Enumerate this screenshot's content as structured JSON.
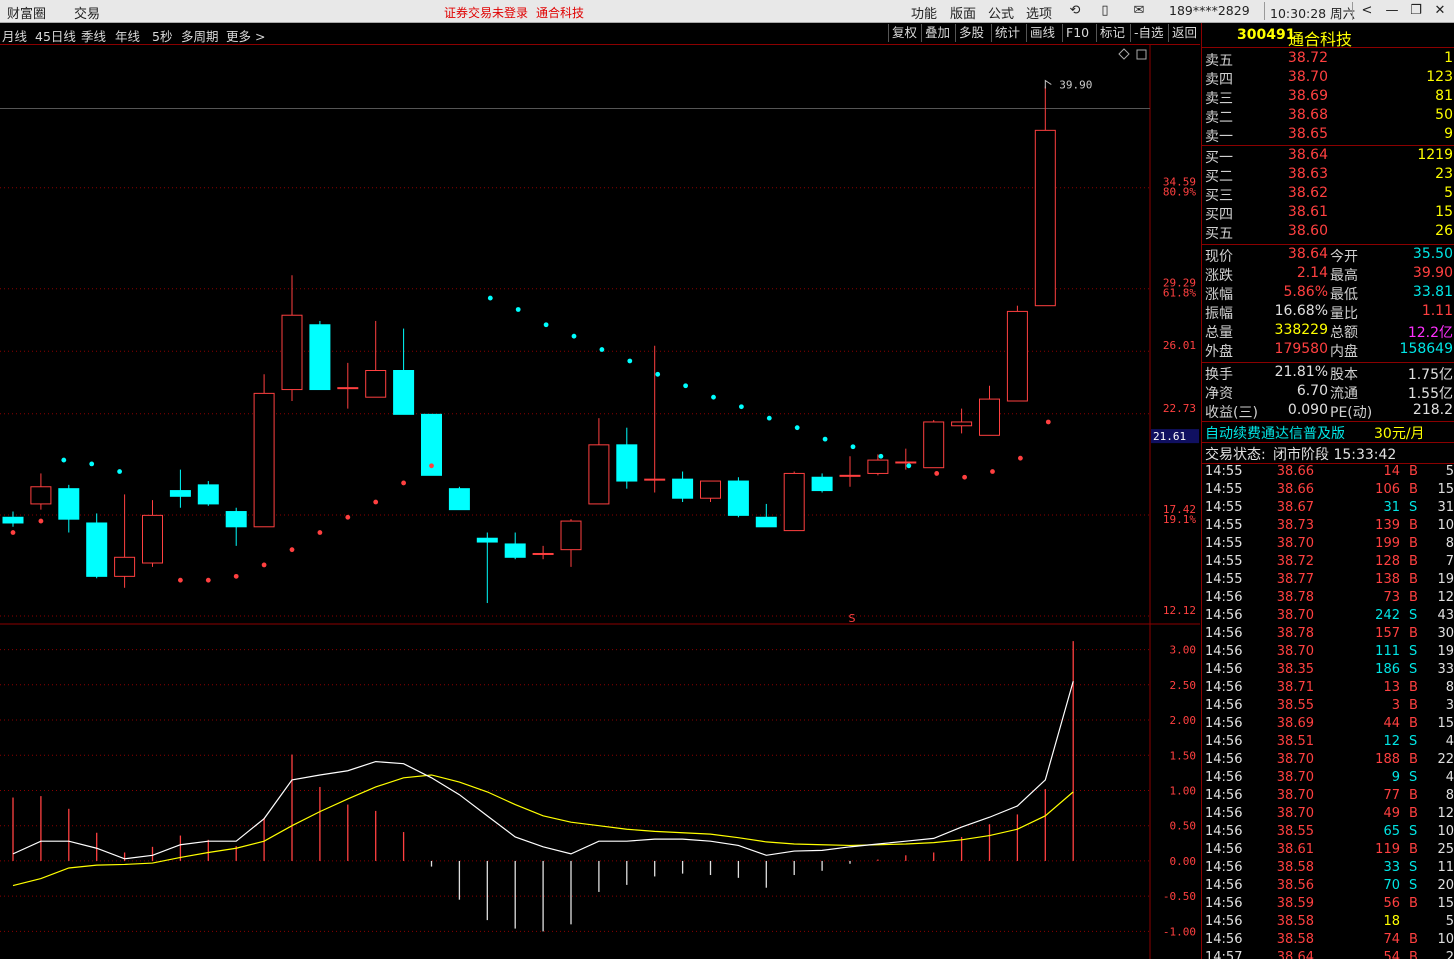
{
  "topbar": {
    "items": [
      "财富圈",
      "交易"
    ],
    "warning": "证券交易未登录",
    "stock_name": "通合科技",
    "menu": [
      "功能",
      "版面",
      "公式",
      "选项"
    ],
    "phone": "189****2829",
    "clock": "10:30:28 周六"
  },
  "toolbar": {
    "periods": [
      "月线",
      "45日线",
      "季线",
      "年线",
      "5秒",
      "多周期",
      "更多 >"
    ],
    "actions": [
      "复权",
      "叠加",
      "多股",
      "统计",
      "画线",
      "F10",
      "标记",
      "-自选",
      "返回"
    ]
  },
  "price_axis": {
    "labels": [
      "34.59",
      "80.9%",
      "29.29",
      "61.8%",
      "26.01",
      "22.73",
      "17.42",
      "19.1%",
      "12.12"
    ],
    "current_tag": "21.61",
    "high_marker": "39.90"
  },
  "macd_axis": {
    "labels": [
      "3.00",
      "2.50",
      "2.00",
      "1.50",
      "1.00",
      "0.50",
      "0.00",
      "-0.50",
      "-1.00"
    ]
  },
  "chart_data": {
    "type": "candlestick",
    "candles": [
      {
        "o": 17.3,
        "c": 17.0,
        "h": 17.6,
        "l": 16.8
      },
      {
        "o": 18.0,
        "c": 18.9,
        "h": 19.6,
        "l": 17.7
      },
      {
        "o": 18.8,
        "c": 17.2,
        "h": 19.0,
        "l": 16.5
      },
      {
        "o": 17.0,
        "c": 14.2,
        "h": 17.5,
        "l": 14.1
      },
      {
        "o": 14.2,
        "c": 15.2,
        "h": 18.5,
        "l": 13.6
      },
      {
        "o": 14.9,
        "c": 17.4,
        "h": 18.2,
        "l": 14.7
      },
      {
        "o": 18.7,
        "c": 18.4,
        "h": 19.8,
        "l": 17.8
      },
      {
        "o": 19.0,
        "c": 18.0,
        "h": 19.2,
        "l": 17.9
      },
      {
        "o": 17.6,
        "c": 16.8,
        "h": 17.8,
        "l": 15.8
      },
      {
        "o": 16.8,
        "c": 23.8,
        "h": 24.8,
        "l": 16.8
      },
      {
        "o": 24.0,
        "c": 27.9,
        "h": 30.0,
        "l": 23.4
      },
      {
        "o": 27.4,
        "c": 24.0,
        "h": 27.6,
        "l": 24.0
      },
      {
        "o": 24.1,
        "c": 24.1,
        "h": 25.4,
        "l": 23.0
      },
      {
        "o": 23.6,
        "c": 25.0,
        "h": 27.6,
        "l": 23.6
      },
      {
        "o": 25.0,
        "c": 22.7,
        "h": 27.2,
        "l": 22.7
      },
      {
        "o": 22.7,
        "c": 19.5,
        "h": 22.7,
        "l": 19.5
      },
      {
        "o": 18.8,
        "c": 17.7,
        "h": 18.9,
        "l": 17.7
      },
      {
        "o": 16.2,
        "c": 16.0,
        "h": 16.5,
        "l": 12.8
      },
      {
        "o": 15.9,
        "c": 15.2,
        "h": 16.5,
        "l": 15.1
      },
      {
        "o": 15.4,
        "c": 15.4,
        "h": 15.8,
        "l": 15.1
      },
      {
        "o": 15.6,
        "c": 17.1,
        "h": 17.2,
        "l": 14.7
      },
      {
        "o": 18.0,
        "c": 21.1,
        "h": 22.5,
        "l": 18.0
      },
      {
        "o": 21.1,
        "c": 19.2,
        "h": 22.0,
        "l": 18.8
      },
      {
        "o": 19.3,
        "c": 19.3,
        "h": 26.3,
        "l": 18.6
      },
      {
        "o": 19.3,
        "c": 18.3,
        "h": 19.7,
        "l": 18.1
      },
      {
        "o": 18.3,
        "c": 19.2,
        "h": 19.2,
        "l": 18.1
      },
      {
        "o": 19.2,
        "c": 17.4,
        "h": 19.4,
        "l": 17.3
      },
      {
        "o": 17.3,
        "c": 16.8,
        "h": 18.0,
        "l": 16.8
      },
      {
        "o": 16.6,
        "c": 19.6,
        "h": 19.7,
        "l": 16.6
      },
      {
        "o": 19.4,
        "c": 18.7,
        "h": 19.6,
        "l": 18.6
      },
      {
        "o": 19.5,
        "c": 19.5,
        "h": 20.5,
        "l": 18.9
      },
      {
        "o": 19.6,
        "c": 20.3,
        "h": 20.6,
        "l": 19.5
      },
      {
        "o": 20.2,
        "c": 20.2,
        "h": 20.9,
        "l": 19.8
      },
      {
        "o": 19.9,
        "c": 22.3,
        "h": 22.4,
        "l": 19.9
      },
      {
        "o": 22.1,
        "c": 22.3,
        "h": 23.0,
        "l": 21.7
      },
      {
        "o": 21.6,
        "c": 23.5,
        "h": 24.2,
        "l": 21.6
      },
      {
        "o": 23.4,
        "c": 28.1,
        "h": 28.4,
        "l": 23.4
      },
      {
        "o": 28.4,
        "c": 37.6,
        "h": 39.9,
        "l": 28.4
      }
    ],
    "sar_dots": [
      16.5,
      17.1,
      0,
      0,
      0,
      0,
      14.0,
      14.0,
      14.2,
      14.8,
      15.6,
      16.5,
      17.3,
      18.1,
      19.1,
      20.0,
      0,
      28.8,
      28.2,
      27.4,
      26.8,
      26.1,
      25.5,
      24.8,
      24.2,
      23.6,
      23.1,
      22.5,
      22.0,
      21.4,
      21.0,
      20.5,
      20.0,
      19.6,
      19.4,
      19.7,
      20.4,
      22.3
    ],
    "sar_upper": [
      20.3,
      20.1,
      19.7
    ],
    "macd_dif": [
      0.1,
      0.28,
      0.28,
      0.18,
      0.03,
      0.08,
      0.23,
      0.28,
      0.28,
      0.6,
      1.15,
      1.22,
      1.28,
      1.41,
      1.38,
      1.18,
      0.94,
      0.64,
      0.34,
      0.2,
      0.1,
      0.28,
      0.28,
      0.31,
      0.31,
      0.28,
      0.22,
      0.08,
      0.14,
      0.15,
      0.2,
      0.24,
      0.28,
      0.32,
      0.48,
      0.62,
      0.78,
      1.15,
      2.55
    ],
    "macd_dea": [
      -0.35,
      -0.25,
      -0.1,
      -0.06,
      -0.05,
      -0.03,
      0.05,
      0.12,
      0.18,
      0.28,
      0.5,
      0.7,
      0.88,
      1.05,
      1.18,
      1.22,
      1.12,
      0.98,
      0.8,
      0.64,
      0.55,
      0.5,
      0.45,
      0.42,
      0.4,
      0.38,
      0.33,
      0.27,
      0.24,
      0.23,
      0.22,
      0.23,
      0.24,
      0.26,
      0.3,
      0.36,
      0.45,
      0.64,
      0.98
    ],
    "macd_bar": [
      0.9,
      0.92,
      0.74,
      0.4,
      0.12,
      0.2,
      0.36,
      0.3,
      0.21,
      0.61,
      1.51,
      1.05,
      0.8,
      0.71,
      0.41,
      -0.08,
      -0.55,
      -0.84,
      -0.96,
      -1.0,
      -0.9,
      -0.44,
      -0.34,
      -0.22,
      -0.18,
      -0.2,
      -0.24,
      -0.38,
      -0.2,
      -0.14,
      -0.04,
      0.02,
      0.08,
      0.12,
      0.34,
      0.52,
      0.66,
      1.02,
      3.12
    ],
    "price_range": [
      12.12,
      41.5
    ],
    "macd_range": [
      -1.25,
      3.15
    ]
  },
  "quote": {
    "code": "300491",
    "name": "通合科技",
    "asks": [
      {
        "label": "卖五",
        "price": "38.72",
        "vol": "1"
      },
      {
        "label": "卖四",
        "price": "38.70",
        "vol": "123"
      },
      {
        "label": "卖三",
        "price": "38.69",
        "vol": "81"
      },
      {
        "label": "卖二",
        "price": "38.68",
        "vol": "50"
      },
      {
        "label": "卖一",
        "price": "38.65",
        "vol": "9"
      }
    ],
    "bids": [
      {
        "label": "买一",
        "price": "38.64",
        "vol": "1219"
      },
      {
        "label": "买二",
        "price": "38.63",
        "vol": "23"
      },
      {
        "label": "买三",
        "price": "38.62",
        "vol": "5"
      },
      {
        "label": "买四",
        "price": "38.61",
        "vol": "15"
      },
      {
        "label": "买五",
        "price": "38.60",
        "vol": "26"
      }
    ],
    "stats1": [
      {
        "l1": "现价",
        "v1": "38.64",
        "c1": "red",
        "l2": "今开",
        "v2": "35.50",
        "c2": "cyan"
      },
      {
        "l1": "涨跌",
        "v1": "2.14",
        "c1": "red",
        "l2": "最高",
        "v2": "39.90",
        "c2": "red"
      },
      {
        "l1": "涨幅",
        "v1": "5.86%",
        "c1": "red",
        "l2": "最低",
        "v2": "33.81",
        "c2": "cyan"
      },
      {
        "l1": "振幅",
        "v1": "16.68%",
        "c1": "wht",
        "l2": "量比",
        "v2": "1.11",
        "c2": "red"
      },
      {
        "l1": "总量",
        "v1": "338229",
        "c1": "yel",
        "l2": "总额",
        "v2": "12.2亿",
        "c2": "mag"
      },
      {
        "l1": "外盘",
        "v1": "179580",
        "c1": "red",
        "l2": "内盘",
        "v2": "158649",
        "c2": "cyan"
      }
    ],
    "stats2": [
      {
        "l1": "换手",
        "v1": "21.81%",
        "l2": "股本",
        "v2": "1.75亿"
      },
      {
        "l1": "净资",
        "v1": "6.70",
        "l2": "流通",
        "v2": "1.55亿"
      },
      {
        "l1": "收益(三)",
        "v1": "0.090",
        "l2": "PE(动)",
        "v2": "218.2"
      }
    ],
    "promo": "自动续费通达信普及版",
    "promo_price": "30元/月",
    "status_label": "交易状态:",
    "status_value": "闭市阶段 15:33:42"
  },
  "ticks": [
    {
      "t": "14:55",
      "p": "38.66",
      "v": "14",
      "s": "B",
      "n": "5"
    },
    {
      "t": "14:55",
      "p": "38.66",
      "v": "106",
      "s": "B",
      "n": "15"
    },
    {
      "t": "14:55",
      "p": "38.67",
      "v": "31",
      "s": "S",
      "n": "31"
    },
    {
      "t": "14:55",
      "p": "38.73",
      "v": "139",
      "s": "B",
      "n": "10"
    },
    {
      "t": "14:55",
      "p": "38.70",
      "v": "199",
      "s": "B",
      "n": "8"
    },
    {
      "t": "14:55",
      "p": "38.72",
      "v": "128",
      "s": "B",
      "n": "7"
    },
    {
      "t": "14:55",
      "p": "38.77",
      "v": "138",
      "s": "B",
      "n": "19"
    },
    {
      "t": "14:56",
      "p": "38.78",
      "v": "73",
      "s": "B",
      "n": "12"
    },
    {
      "t": "14:56",
      "p": "38.70",
      "v": "242",
      "s": "S",
      "n": "43"
    },
    {
      "t": "14:56",
      "p": "38.78",
      "v": "157",
      "s": "B",
      "n": "30"
    },
    {
      "t": "14:56",
      "p": "38.70",
      "v": "111",
      "s": "S",
      "n": "19"
    },
    {
      "t": "14:56",
      "p": "38.35",
      "v": "186",
      "s": "S",
      "n": "33"
    },
    {
      "t": "14:56",
      "p": "38.71",
      "v": "13",
      "s": "B",
      "n": "8"
    },
    {
      "t": "14:56",
      "p": "38.55",
      "v": "3",
      "s": "B",
      "n": "3"
    },
    {
      "t": "14:56",
      "p": "38.69",
      "v": "44",
      "s": "B",
      "n": "15"
    },
    {
      "t": "14:56",
      "p": "38.51",
      "v": "12",
      "s": "S",
      "n": "4"
    },
    {
      "t": "14:56",
      "p": "38.70",
      "v": "188",
      "s": "B",
      "n": "22"
    },
    {
      "t": "14:56",
      "p": "38.70",
      "v": "9",
      "s": "S",
      "n": "4"
    },
    {
      "t": "14:56",
      "p": "38.70",
      "v": "77",
      "s": "B",
      "n": "8"
    },
    {
      "t": "14:56",
      "p": "38.70",
      "v": "49",
      "s": "B",
      "n": "12"
    },
    {
      "t": "14:56",
      "p": "38.55",
      "v": "65",
      "s": "S",
      "n": "10"
    },
    {
      "t": "14:56",
      "p": "38.61",
      "v": "119",
      "s": "B",
      "n": "25"
    },
    {
      "t": "14:56",
      "p": "38.58",
      "v": "33",
      "s": "S",
      "n": "11"
    },
    {
      "t": "14:56",
      "p": "38.56",
      "v": "70",
      "s": "S",
      "n": "20"
    },
    {
      "t": "14:56",
      "p": "38.59",
      "v": "56",
      "s": "B",
      "n": "15"
    },
    {
      "t": "14:56",
      "p": "38.58",
      "v": "18",
      "s": "",
      "n": "5"
    },
    {
      "t": "14:56",
      "p": "38.58",
      "v": "74",
      "s": "B",
      "n": "10"
    },
    {
      "t": "14:57",
      "p": "38.64",
      "v": "54",
      "s": "B",
      "n": "2"
    }
  ],
  "colors": {
    "up": "#ff4040",
    "down": "#00ffff",
    "grid": "#8b0000",
    "dif": "#ffffff",
    "dea": "#ffff00"
  }
}
